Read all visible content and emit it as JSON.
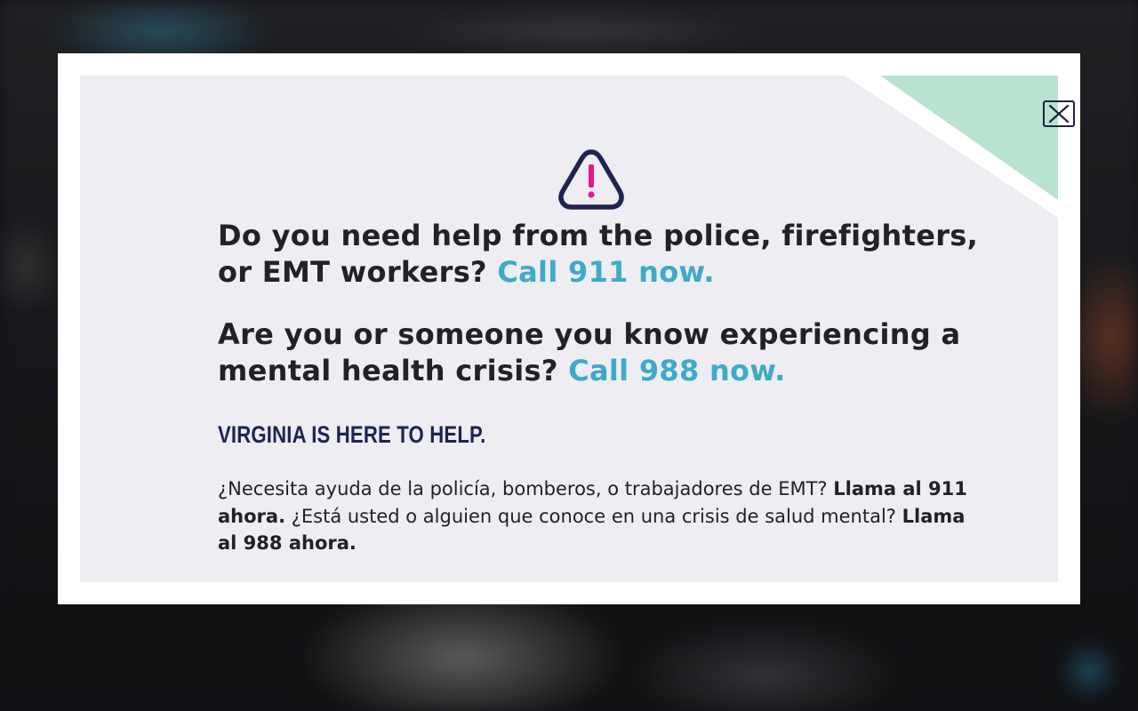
{
  "modal": {
    "close_label": "Close",
    "icon": "warning-triangle-icon",
    "accent_colors": {
      "cta": "#3fa9c9",
      "exclamation": "#e6178e",
      "navy": "#1e2350",
      "corner": "#b7e3d0"
    },
    "emergency": {
      "question": "Do you need help from the police, firefighters, or EMT workers? ",
      "cta": "Call 911 now."
    },
    "crisis": {
      "question": "Are you or someone you know experiencing a mental health crisis? ",
      "cta": "Call 988 now."
    },
    "tagline": "VIRGINIA IS HERE TO HELP.",
    "spanish": {
      "part1": "¿Necesita ayuda de la policía, bomberos, o trabajadores de EMT? ",
      "bold1": "Llama al 911 ahora.",
      "part2": " ¿Está usted o alguien que conoce en una crisis de salud mental? ",
      "bold2": "Llama al 988 ahora."
    }
  }
}
